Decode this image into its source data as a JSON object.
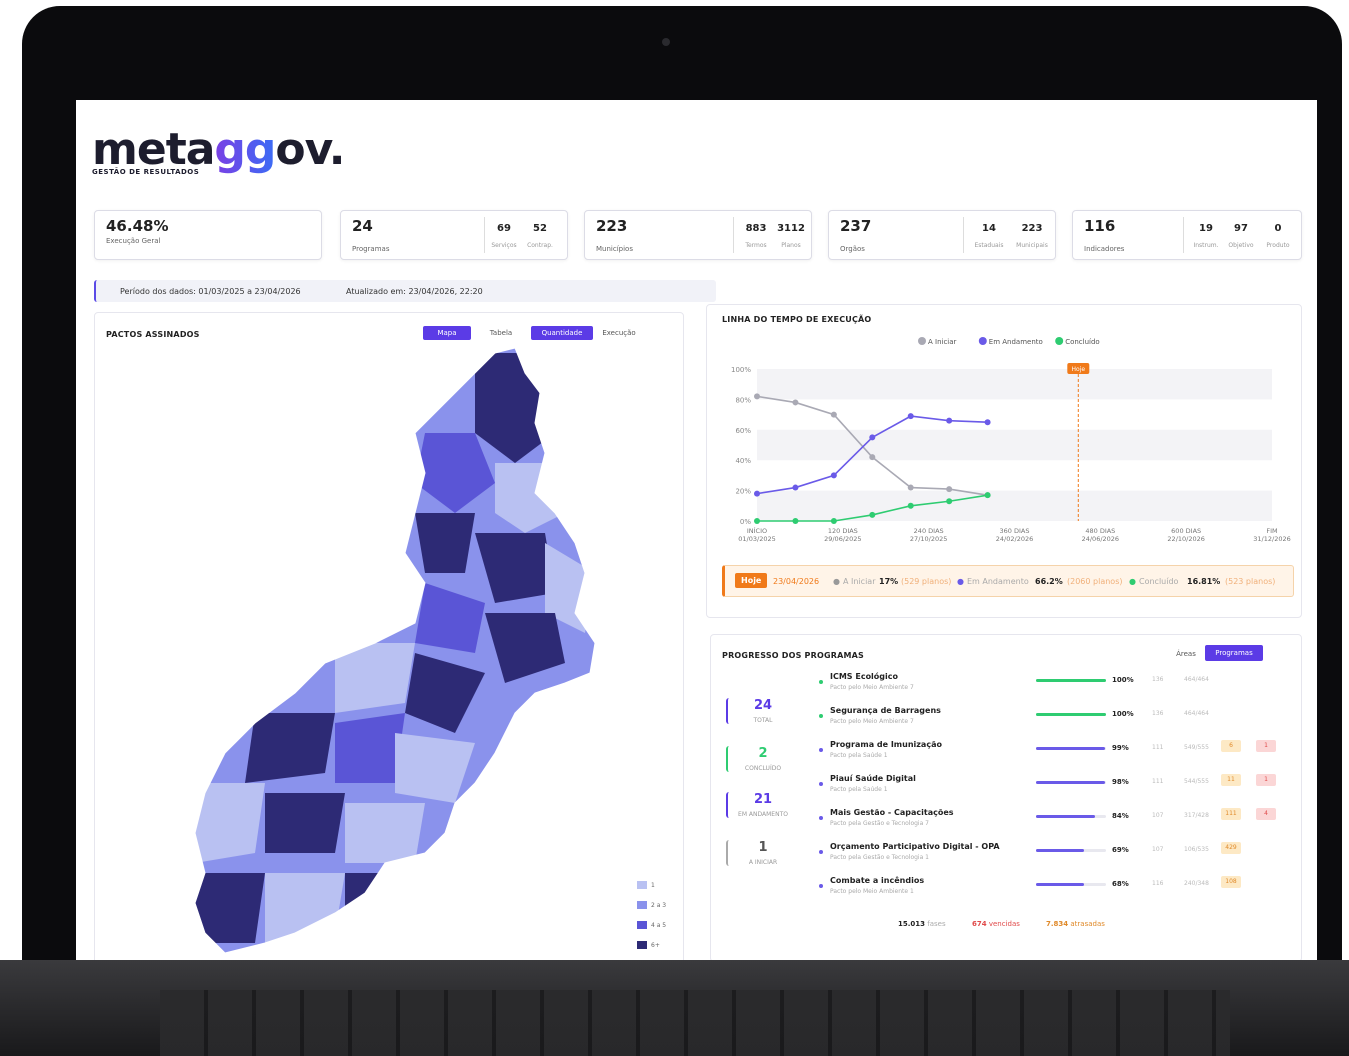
{
  "brand": {
    "logo_pre": "meta",
    "logo_gg": "gg",
    "logo_post": "ov.",
    "tagline": "GESTÃO DE RESULTADOS"
  },
  "kpis": [
    {
      "value": "46.48%",
      "label": "Execução Geral",
      "subs": []
    },
    {
      "value": "24",
      "label": "Programas",
      "subs": [
        {
          "n": "69",
          "l": "Serviços"
        },
        {
          "n": "52",
          "l": "Contrap."
        }
      ]
    },
    {
      "value": "223",
      "label": "Municípios",
      "subs": [
        {
          "n": "883",
          "l": "Termos"
        },
        {
          "n": "3112",
          "l": "Planos"
        }
      ]
    },
    {
      "value": "237",
      "label": "Orgãos",
      "subs": [
        {
          "n": "14",
          "l": "Estaduais"
        },
        {
          "n": "223",
          "l": "Municipais"
        }
      ]
    },
    {
      "value": "116",
      "label": "Indicadores",
      "subs": [
        {
          "n": "19",
          "l": "Instrum."
        },
        {
          "n": "97",
          "l": "Objetivo"
        },
        {
          "n": "0",
          "l": "Produto"
        }
      ]
    }
  ],
  "period": {
    "range": "Período dos dados: 01/03/2025 a 23/04/2026",
    "updated": "Atualizado em: 23/04/2026, 22:20"
  },
  "map_panel": {
    "title": "PACTOS ASSINADOS",
    "tabs": [
      "Mapa",
      "Tabela",
      "Quantidade",
      "Execução"
    ],
    "legend": [
      {
        "label": "1",
        "color": "#b9c1f2"
      },
      {
        "label": "2 a 3",
        "color": "#8a92ec"
      },
      {
        "label": "4 a 5",
        "color": "#5a55d6"
      },
      {
        "label": "6+",
        "color": "#2d2a75"
      }
    ]
  },
  "timeline_panel": {
    "title": "LINHA DO TEMPO DE EXECUÇÃO",
    "today_marker": "Hoje",
    "today_bar": {
      "tag": "Hoje",
      "date": "23/04/2026",
      "a_iniciar_label": "A Iniciar",
      "a_iniciar_pct": "17%",
      "a_iniciar_count": "(529 planos)",
      "andamento_label": "Em Andamento",
      "andamento_pct": "66.2%",
      "andamento_count": "(2060 planos)",
      "concluido_label": "Concluído",
      "concluido_pct": "16.81%",
      "concluido_count": "(523 planos)"
    }
  },
  "chart_data": {
    "type": "line",
    "title": "LINHA DO TEMPO DE EXECUÇÃO",
    "x_ticks": [
      {
        "top": "INÍCIO",
        "bottom": "01/03/2025"
      },
      {
        "top": "120 DIAS",
        "bottom": "29/06/2025"
      },
      {
        "top": "240 DIAS",
        "bottom": "27/10/2025"
      },
      {
        "top": "360 DIAS",
        "bottom": "24/02/2026"
      },
      {
        "top": "480 DIAS",
        "bottom": "24/06/2026"
      },
      {
        "top": "600 DIAS",
        "bottom": "22/10/2026"
      },
      {
        "top": "FIM",
        "bottom": "31/12/2026"
      }
    ],
    "xlim": [
      0,
      670
    ],
    "ylim": [
      0,
      100
    ],
    "y_ticks": [
      "0%",
      "20%",
      "40%",
      "60%",
      "80%",
      "100%"
    ],
    "today_x": 418,
    "legend_position": "top-center",
    "series": [
      {
        "name": "A Iniciar",
        "color": "#a9a9b4",
        "x": [
          0,
          50,
          100,
          150,
          200,
          250,
          300
        ],
        "values": [
          82,
          78,
          70,
          42,
          22,
          21,
          17
        ]
      },
      {
        "name": "Em Andamento",
        "color": "#6a5ae8",
        "x": [
          0,
          50,
          100,
          150,
          200,
          250,
          300
        ],
        "values": [
          18,
          22,
          30,
          55,
          69,
          66,
          65
        ]
      },
      {
        "name": "Concluído",
        "color": "#2ecc71",
        "x": [
          0,
          50,
          100,
          150,
          200,
          250,
          300
        ],
        "values": [
          0,
          0,
          0,
          4,
          10,
          13,
          17
        ]
      }
    ]
  },
  "programs_panel": {
    "title": "PROGRESSO DOS PROGRAMAS",
    "tabs": [
      "Áreas",
      "Programas"
    ],
    "stats": [
      {
        "n": "24",
        "l": "TOTAL",
        "color": "#5b3be6"
      },
      {
        "n": "2",
        "l": "CONCLUÍDO",
        "color": "#2ecc71"
      },
      {
        "n": "21",
        "l": "EM ANDAMENTO",
        "color": "#5b3be6"
      },
      {
        "n": "1",
        "l": "A INICIAR",
        "color": "#aaaaaa"
      }
    ],
    "rows": [
      {
        "name": "ICMS Ecológico",
        "desc": "Pacto pelo Meio Ambiente 7",
        "pct": "100%",
        "progress": 100,
        "c1": "136",
        "c2": "464/464",
        "b1": "",
        "b2": "",
        "color": "#2ecc71"
      },
      {
        "name": "Segurança de Barragens",
        "desc": "Pacto pelo Meio Ambiente 7",
        "pct": "100%",
        "progress": 100,
        "c1": "136",
        "c2": "464/464",
        "b1": "",
        "b2": "",
        "color": "#2ecc71"
      },
      {
        "name": "Programa de Imunização",
        "desc": "Pacto pela Saúde 1",
        "pct": "99%",
        "progress": 99,
        "c1": "111",
        "c2": "549/555",
        "b1": "6",
        "b2": "1",
        "color": "#6a5ae8"
      },
      {
        "name": "Piauí Saúde Digital",
        "desc": "Pacto pela Saúde 1",
        "pct": "98%",
        "progress": 98,
        "c1": "111",
        "c2": "544/555",
        "b1": "11",
        "b2": "1",
        "color": "#6a5ae8"
      },
      {
        "name": "Mais Gestão - Capacitações",
        "desc": "Pacto pela Gestão e Tecnologia 7",
        "pct": "84%",
        "progress": 84,
        "c1": "107",
        "c2": "317/428",
        "b1": "111",
        "b2": "4",
        "color": "#6a5ae8"
      },
      {
        "name": "Orçamento Participativo Digital - OPA",
        "desc": "Pacto pela Gestão e Tecnologia 1",
        "pct": "69%",
        "progress": 69,
        "c1": "107",
        "c2": "106/535",
        "b1": "429",
        "b2": "",
        "color": "#6a5ae8"
      },
      {
        "name": "Combate a incêndios",
        "desc": "Pacto pelo Meio Ambiente 1",
        "pct": "68%",
        "progress": 68,
        "c1": "116",
        "c2": "240/348",
        "b1": "108",
        "b2": "",
        "color": "#6a5ae8"
      }
    ],
    "footer": {
      "f1n": "15.013",
      "f1l": "fases",
      "f2n": "674",
      "f2l": "vencidas",
      "f3n": "7.834",
      "f3l": "atrasadas"
    }
  }
}
